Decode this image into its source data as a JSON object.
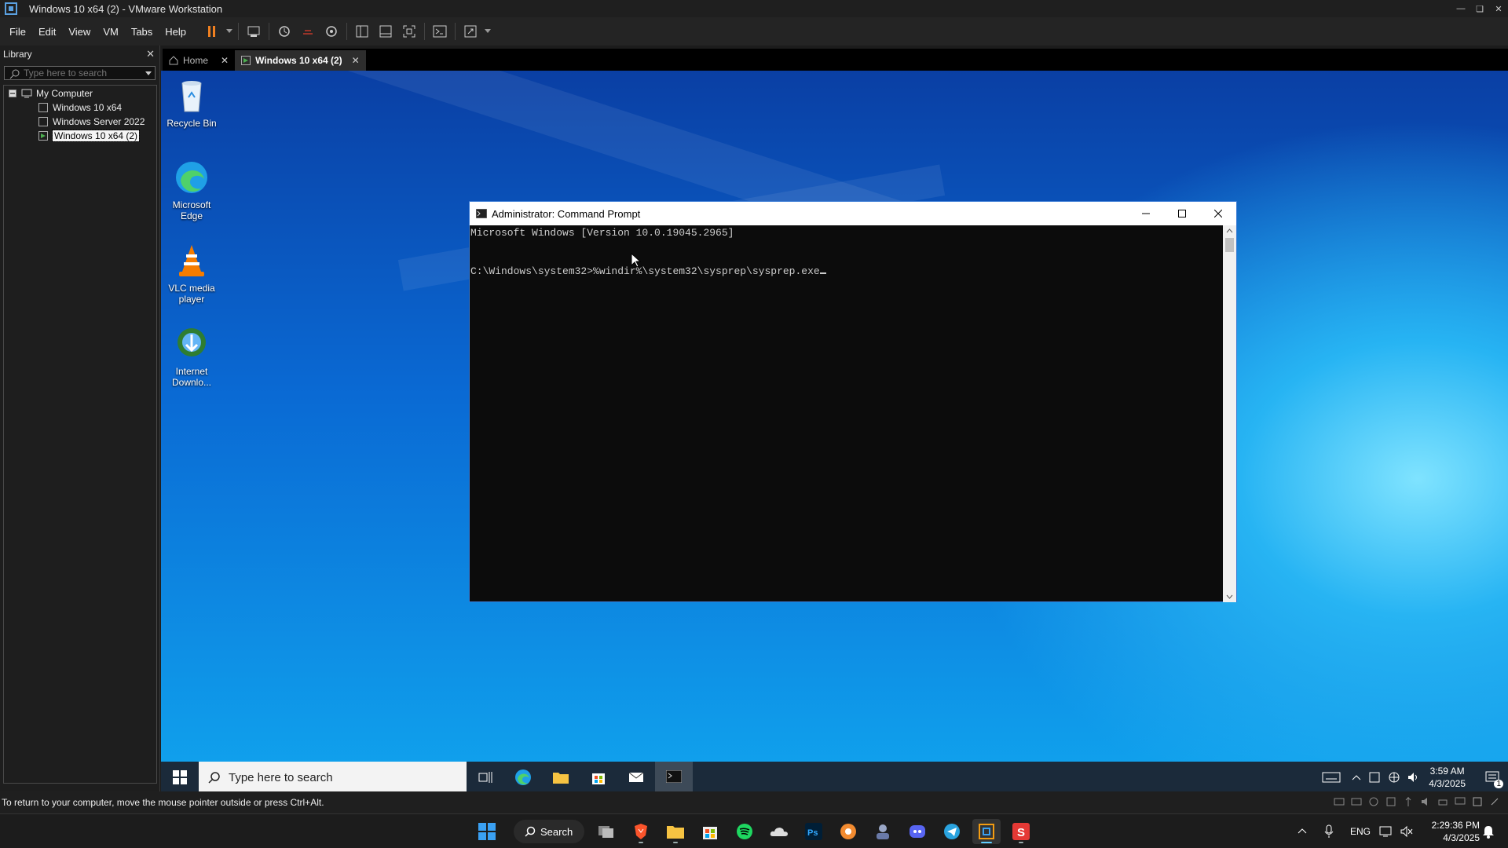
{
  "window": {
    "title": "Windows 10 x64 (2) - VMware Workstation"
  },
  "menu": [
    "File",
    "Edit",
    "View",
    "VM",
    "Tabs",
    "Help"
  ],
  "library": {
    "title": "Library",
    "search_placeholder": "Type here to search",
    "root": "My Computer",
    "items": [
      "Windows 10 x64",
      "Windows Server 2022",
      "Windows 10 x64 (2)"
    ],
    "selected": "Windows 10 x64 (2)"
  },
  "tabs": [
    {
      "label": "Home",
      "active": false
    },
    {
      "label": "Windows 10 x64 (2)",
      "active": true
    }
  ],
  "desktop_icons": [
    {
      "label": "Recycle Bin",
      "icon": "recycle-bin-icon"
    },
    {
      "label": "Microsoft Edge",
      "icon": "edge-icon"
    },
    {
      "label": "VLC media player",
      "icon": "vlc-icon"
    },
    {
      "label": "Internet Downlo...",
      "icon": "idm-icon"
    }
  ],
  "cmd": {
    "title": "Administrator: Command Prompt",
    "line1": "Microsoft Windows [Version 10.0.19045.2965]",
    "prompt": "C:\\Windows\\system32>",
    "command": "%windir%\\system32\\sysprep\\sysprep.exe"
  },
  "guest_taskbar": {
    "search_placeholder": "Type here to search",
    "tray": {
      "time": "3:59 AM",
      "date": "4/3/2025",
      "notifications": "1"
    }
  },
  "status_bar": {
    "message": "To return to your computer, move the mouse pointer outside or press Ctrl+Alt."
  },
  "host_taskbar": {
    "search_label": "Search",
    "lang": "ENG",
    "time": "2:29:36 PM",
    "date": "4/3/2025"
  },
  "colors": {
    "cmd_bg": "#0c0c0c",
    "accent": "#76b9ed",
    "desktop": "#0a6ad4"
  }
}
